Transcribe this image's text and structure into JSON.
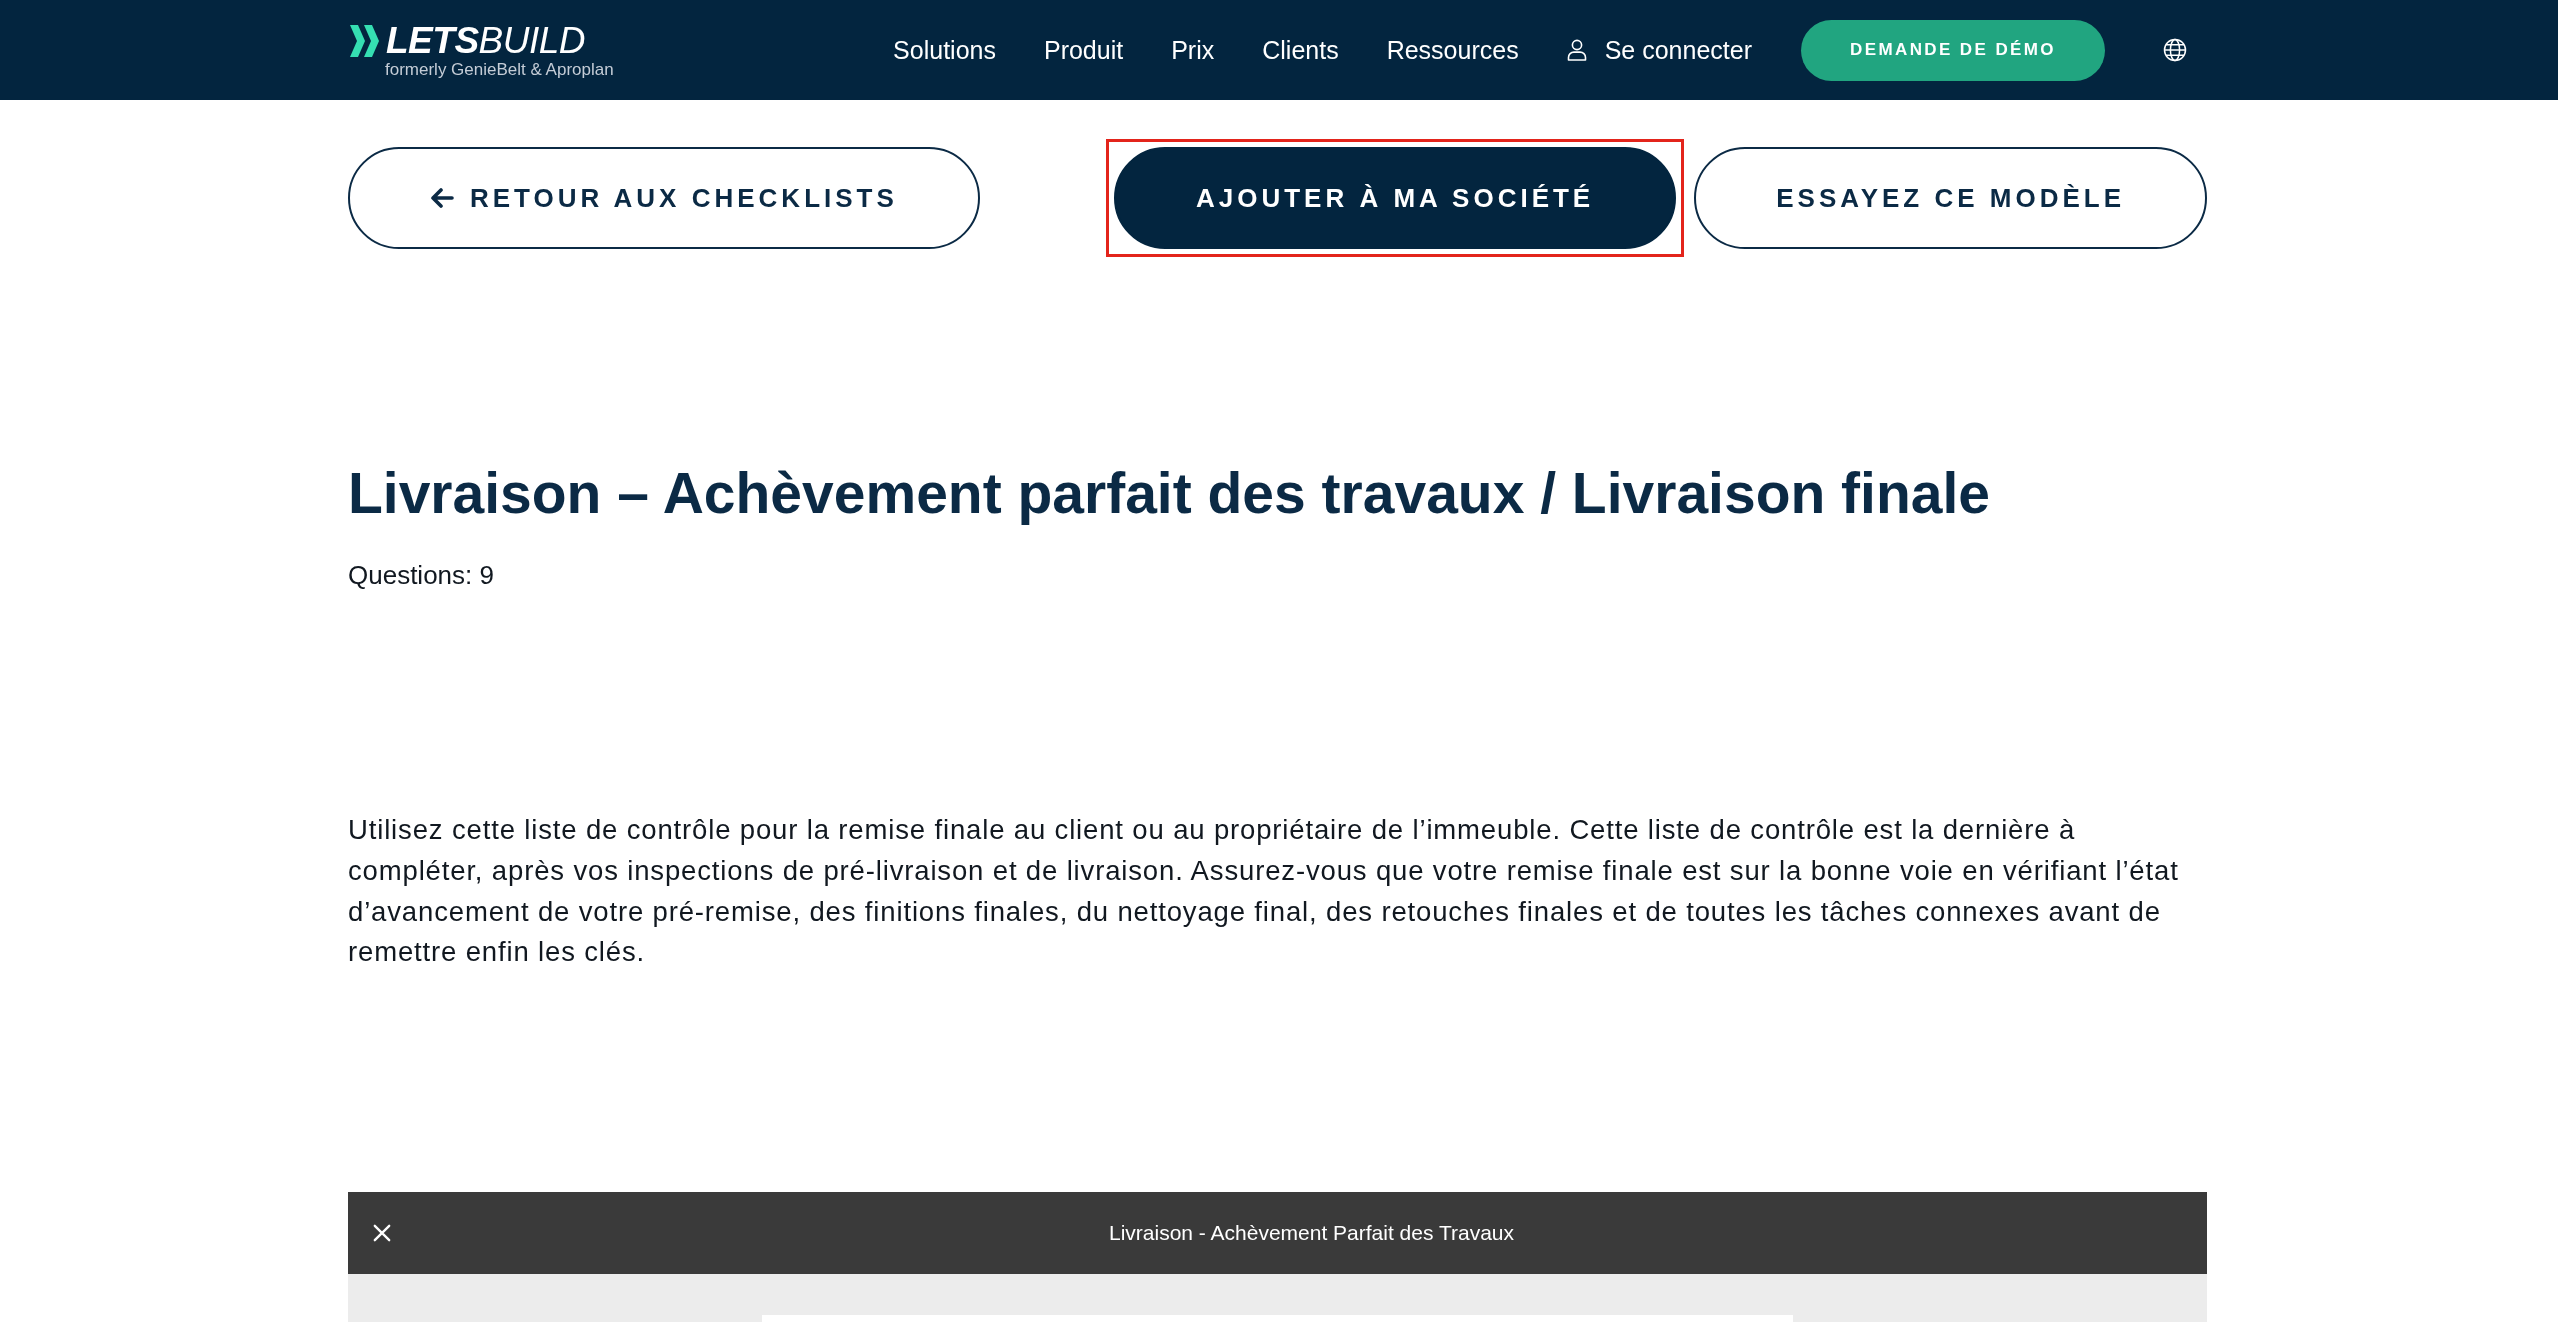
{
  "header": {
    "logo": "**LETS**BUILD",
    "logo_tagline": "formerly GenieBelt & Aproplan",
    "nav": [
      "Solutions",
      "Produit",
      "Prix",
      "Clients",
      "Ressources"
    ],
    "login": "Se connecter",
    "demo_button": "DEMANDE DE DÉMO"
  },
  "actions": [
    {
      "kind": "back",
      "label": "RETOUR AUX CHECKLISTS",
      "primary": false,
      "highlighted": false
    },
    {
      "kind": "add",
      "label": "AJOUTER À MA SOCIÉTÉ",
      "primary": true,
      "highlighted": true
    },
    {
      "kind": "try",
      "label": "ESSAYEZ CE MODÈLE",
      "primary": false,
      "highlighted": false
    }
  ],
  "title": "Livraison – Achèvement parfait des travaux / Livraison finale",
  "questions": "Questions: 9",
  "description": "Utilisez cette liste de contrôle pour la remise finale au client ou au propriétaire de l’immeuble. Cette liste de contrôle est la dernière à compléter, après vos inspections de pré-livraison et de livraison. Assurez-vous que votre remise finale est sur la bonne voie en vérifiant l’état d’avancement de votre pré-remise, des finitions finales, du nettoyage final, des retouches finales et de toutes les tâches connexes avant de remettre enfin les clés.",
  "viewer": {
    "title": "Livraison - Achèvement Parfait des Travaux"
  }
}
